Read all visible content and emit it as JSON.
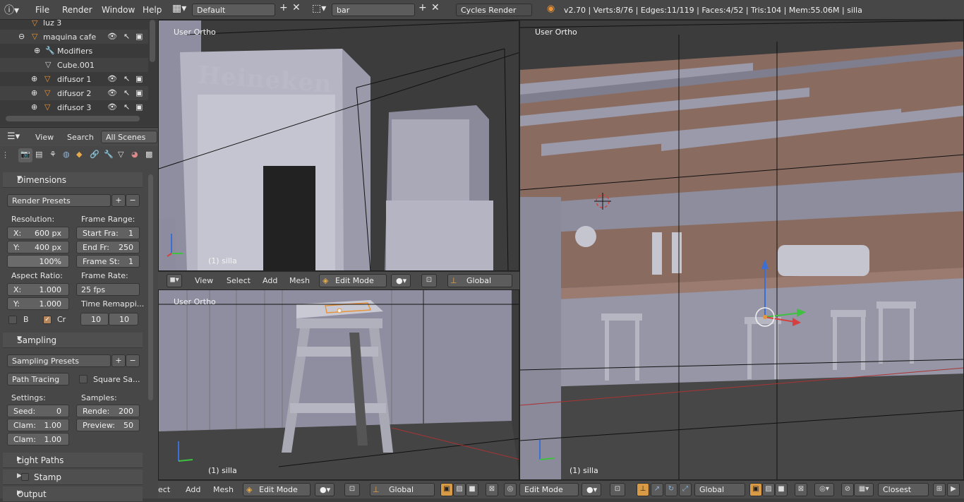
{
  "topbar": {
    "menus": [
      "File",
      "Render",
      "Window",
      "Help"
    ],
    "screen_layout": "Default",
    "scene": "bar",
    "render_engine": "Cycles Render",
    "stats": "v2.70 | Verts:8/76 | Edges:11/119 | Faces:4/52 | Tris:104 | Mem:55.06M | silla"
  },
  "outliner": {
    "items": [
      {
        "name": "luz 3"
      },
      {
        "name": "maquina cafe"
      },
      {
        "name": "Modifiers"
      },
      {
        "name": "Cube.001"
      },
      {
        "name": "difusor 1"
      },
      {
        "name": "difusor 2"
      },
      {
        "name": "difusor 3"
      }
    ]
  },
  "outliner_header": {
    "view": "View",
    "search": "Search",
    "filter": "All Scenes"
  },
  "dimensions": {
    "title": "Dimensions",
    "presets": "Render Presets",
    "resolution_label": "Resolution:",
    "res_x_label": "X:",
    "res_x": "600 px",
    "res_y_label": "Y:",
    "res_y": "400 px",
    "res_pct": "100%",
    "frame_range_label": "Frame Range:",
    "start_label": "Start Fra:",
    "start": "1",
    "end_label": "End Fr:",
    "end": "250",
    "step_label": "Frame St:",
    "step": "1",
    "aspect_label": "Aspect Ratio:",
    "asp_x_label": "X:",
    "asp_x": "1.000",
    "asp_y_label": "Y:",
    "asp_y": "1.000",
    "frame_rate_label": "Frame Rate:",
    "frame_rate": "25 fps",
    "time_remap_label": "Time Remappi...",
    "remap_old": "10",
    "remap_new": "10",
    "border_label": "B",
    "crop_label": "Cr"
  },
  "sampling": {
    "title": "Sampling",
    "presets": "Sampling Presets",
    "integrator": "Path Tracing",
    "square_label": "Square Sa...",
    "settings_label": "Settings:",
    "seed_label": "Seed:",
    "seed": "0",
    "clamp1_label": "Clam:",
    "clamp1": "1.00",
    "clamp2_label": "Clam:",
    "clamp2": "1.00",
    "samples_label": "Samples:",
    "render_label": "Rende:",
    "render": "200",
    "preview_label": "Preview:",
    "preview": "50"
  },
  "collapsed_panels": [
    "Light Paths",
    "Stamp",
    "Output"
  ],
  "viewport_top_left": {
    "label": "User Ortho",
    "object": "(1) silla",
    "menus": [
      "View",
      "Select",
      "Add",
      "Mesh"
    ],
    "mode": "Edit Mode",
    "orientation": "Global"
  },
  "viewport_bottom_left": {
    "label": "User Ortho",
    "object": "(1) silla",
    "menus": [
      "ect",
      "Add",
      "Mesh"
    ],
    "mode": "Edit Mode",
    "orientation": "Global"
  },
  "viewport_right": {
    "label": "User Ortho",
    "object": "(1) silla",
    "mode": "Edit Mode",
    "orientation": "Global",
    "snap_target": "Closest"
  },
  "scene_text": {
    "fridge_brand": "Heineken"
  },
  "colors": {
    "header": "#474747",
    "panel": "#474747",
    "viewport_bg": "#3d3d3d",
    "mesh": "#9a9aaa",
    "wood": "#8c6a5c",
    "accent": "#d99a45"
  }
}
